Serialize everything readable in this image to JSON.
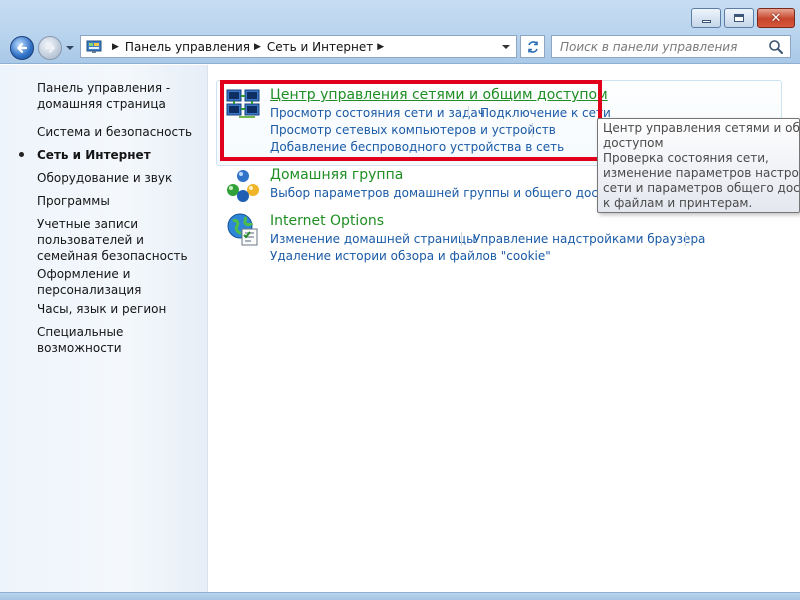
{
  "window": {
    "minimize_icon": "minimize-icon",
    "maximize_icon": "maximize-icon",
    "close_icon": "close-icon",
    "close_glyph": "✕"
  },
  "navigation": {
    "back_icon": "back-arrow-icon",
    "forward_icon": "forward-arrow-icon",
    "recent_pages_icon": "chevron-down-icon"
  },
  "address": {
    "icon": "control-panel-icon",
    "breadcrumbs": [
      "Панель управления",
      "Сеть и Интернет"
    ]
  },
  "search": {
    "placeholder": "Поиск в панели управления",
    "value": ""
  },
  "sidebar": {
    "items": [
      {
        "label": "Панель управления - домашняя страница",
        "active": false
      },
      {
        "label": "Система и безопасность",
        "active": false
      },
      {
        "label": "Сеть и Интернет",
        "active": true
      },
      {
        "label": "Оборудование и звук",
        "active": false
      },
      {
        "label": "Программы",
        "active": false
      },
      {
        "label": "Учетные записи пользователей и семейная безопасность",
        "active": false
      },
      {
        "label": "Оформление и персонализация",
        "active": false
      },
      {
        "label": "Часы, язык и регион",
        "active": false
      },
      {
        "label": "Специальные возможности",
        "active": false
      }
    ]
  },
  "categories": [
    {
      "title": "Центр управления сетями и общим доступом",
      "icon": "network-center-icon",
      "tasks": [
        "Просмотр состояния сети и задач",
        "Подключение к сети",
        "Просмотр сетевых компьютеров и устройств",
        "Добавление беспроводного устройства в сеть"
      ]
    },
    {
      "title": "Домашняя группа",
      "icon": "homegroup-icon",
      "tasks": [
        "Выбор параметров домашней группы и общего доступа к"
      ]
    },
    {
      "title": "Internet Options",
      "icon": "internet-options-icon",
      "tasks": [
        "Изменение домашней страницы",
        "Управление надстройками браузера",
        "Удаление истории обзора и файлов \"cookie\""
      ]
    }
  ],
  "tooltip": {
    "lines": [
      "Центр управления сетями и общим",
      "доступом",
      "Проверка состояния сети,",
      "изменение параметров настройки",
      "сети и параметров общего доступа",
      "к файлам и принтерам."
    ]
  },
  "colors": {
    "category_title": "#1f8e23",
    "link": "#1a5aa6",
    "highlight_box": "#e0001b"
  }
}
